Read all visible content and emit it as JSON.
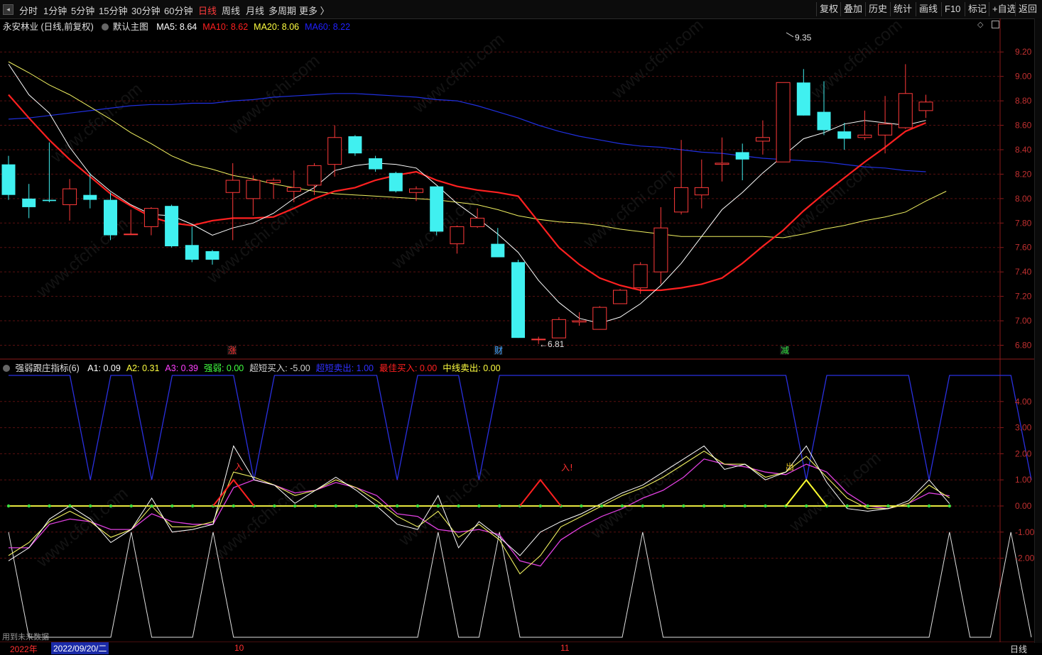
{
  "toolbar": {
    "periods": [
      "分时",
      "1分钟",
      "5分钟",
      "15分钟",
      "30分钟",
      "60分钟",
      "日线",
      "周线",
      "月线",
      "多周期",
      "更多 〉"
    ],
    "active_period": "日线",
    "right_buttons": [
      "复权",
      "叠加",
      "历史",
      "统计",
      "画线",
      "F10",
      "标记",
      "+自选",
      "返回"
    ]
  },
  "main_chart": {
    "stock_title": "永安林业 (日线,前复权)",
    "template": "默认主图",
    "ma": [
      {
        "label": "MA5: 8.64",
        "color": "#ffffff"
      },
      {
        "label": "MA10: 8.62",
        "color": "#ff2020"
      },
      {
        "label": "MA20: 8.06",
        "color": "#ffff40"
      },
      {
        "label": "MA60: 8.22",
        "color": "#2020ff"
      }
    ],
    "y_ticks": [
      "9.20",
      "9.00",
      "8.80",
      "8.60",
      "8.40",
      "8.20",
      "8.00",
      "7.80",
      "7.60",
      "7.40",
      "7.20",
      "7.00",
      "6.80"
    ],
    "high_label": "9.35",
    "low_label": "←6.81",
    "event_marks": [
      {
        "text": "涨",
        "color": "#ff3030"
      },
      {
        "text": "财",
        "color": "#40a0ff"
      },
      {
        "text": "减",
        "color": "#30e040"
      }
    ]
  },
  "indicator": {
    "name": "强弱跟庄指标(6)",
    "values": [
      {
        "label": "A1: 0.09",
        "color": "#ffffff"
      },
      {
        "label": "A2: 0.31",
        "color": "#ffff40"
      },
      {
        "label": "A3: 0.39",
        "color": "#ff40ff"
      },
      {
        "label": "强弱: 0.00",
        "color": "#40ff40"
      },
      {
        "label": "超短买入: -5.00",
        "color": "#d0d0d0"
      },
      {
        "label": "超短卖出: 1.00",
        "color": "#3030ff"
      },
      {
        "label": "最佳买入: 0.00",
        "color": "#ff2020"
      },
      {
        "label": "中线卖出: 0.00",
        "color": "#ffff40"
      }
    ],
    "y_ticks": [
      "4.00",
      "3.00",
      "2.00",
      "1.00",
      "0.00",
      "-1.00",
      "-2.00"
    ],
    "signals": [
      "入",
      "入!",
      "出"
    ],
    "footnote": "用到未来数据"
  },
  "bottom": {
    "year_label": "2022年",
    "cursor_date": "2022/09/20/二",
    "month_labels": [
      "10",
      "11"
    ],
    "period_label": "日线"
  },
  "watermark": "www.cfchi.com",
  "colors": {
    "up": "#ff3a3a",
    "down": "#40f0f0",
    "ma5": "#ffffff",
    "ma10": "#ff2020",
    "ma20": "#f0f060",
    "ma60": "#2030e0",
    "grid": "#5a1010",
    "axis": "#8b1a1a"
  },
  "candles": [
    {
      "o": 8.28,
      "h": 8.35,
      "l": 7.99,
      "c": 8.03
    },
    {
      "o": 8.0,
      "h": 8.12,
      "l": 7.84,
      "c": 7.93
    },
    {
      "o": 7.99,
      "h": 8.46,
      "l": 7.97,
      "c": 7.98
    },
    {
      "o": 7.95,
      "h": 8.16,
      "l": 7.82,
      "c": 8.08
    },
    {
      "o": 8.03,
      "h": 8.21,
      "l": 7.92,
      "c": 7.99
    },
    {
      "o": 7.99,
      "h": 8.05,
      "l": 7.66,
      "c": 7.7
    },
    {
      "o": 7.71,
      "h": 7.91,
      "l": 7.71,
      "c": 7.71
    },
    {
      "o": 7.77,
      "h": 7.93,
      "l": 7.7,
      "c": 7.92
    },
    {
      "o": 7.94,
      "h": 7.95,
      "l": 7.6,
      "c": 7.61
    },
    {
      "o": 7.62,
      "h": 7.77,
      "l": 7.48,
      "c": 7.5
    },
    {
      "o": 7.57,
      "h": 7.58,
      "l": 7.46,
      "c": 7.5
    },
    {
      "o": 8.05,
      "h": 8.29,
      "l": 7.66,
      "c": 8.15
    },
    {
      "o": 8.0,
      "h": 8.19,
      "l": 7.86,
      "c": 8.15
    },
    {
      "o": 8.13,
      "h": 8.17,
      "l": 8.0,
      "c": 8.15
    },
    {
      "o": 8.06,
      "h": 8.23,
      "l": 7.97,
      "c": 8.09
    },
    {
      "o": 8.11,
      "h": 8.29,
      "l": 8.03,
      "c": 8.27
    },
    {
      "o": 8.28,
      "h": 8.6,
      "l": 8.18,
      "c": 8.5
    },
    {
      "o": 8.51,
      "h": 8.52,
      "l": 8.35,
      "c": 8.37
    },
    {
      "o": 8.33,
      "h": 8.35,
      "l": 8.22,
      "c": 8.24
    },
    {
      "o": 8.21,
      "h": 8.22,
      "l": 8.05,
      "c": 8.06
    },
    {
      "o": 8.05,
      "h": 8.1,
      "l": 7.98,
      "c": 8.08
    },
    {
      "o": 8.1,
      "h": 8.1,
      "l": 7.7,
      "c": 7.73
    },
    {
      "o": 7.63,
      "h": 7.78,
      "l": 7.55,
      "c": 7.77
    },
    {
      "o": 7.77,
      "h": 7.92,
      "l": 7.76,
      "c": 7.84
    },
    {
      "o": 7.63,
      "h": 7.76,
      "l": 7.52,
      "c": 7.52
    },
    {
      "o": 7.48,
      "h": 7.5,
      "l": 6.86,
      "c": 6.86
    },
    {
      "o": 6.85,
      "h": 6.87,
      "l": 6.81,
      "c": 6.85
    },
    {
      "o": 6.86,
      "h": 7.03,
      "l": 6.86,
      "c": 7.01
    },
    {
      "o": 6.99,
      "h": 7.07,
      "l": 6.96,
      "c": 7.0
    },
    {
      "o": 6.93,
      "h": 7.12,
      "l": 6.93,
      "c": 7.11
    },
    {
      "o": 7.14,
      "h": 7.26,
      "l": 7.14,
      "c": 7.25
    },
    {
      "o": 7.27,
      "h": 7.48,
      "l": 7.22,
      "c": 7.46
    },
    {
      "o": 7.4,
      "h": 7.93,
      "l": 7.3,
      "c": 7.76
    },
    {
      "o": 7.89,
      "h": 8.48,
      "l": 7.87,
      "c": 8.09
    },
    {
      "o": 8.03,
      "h": 8.32,
      "l": 7.92,
      "c": 8.09
    },
    {
      "o": 8.28,
      "h": 8.5,
      "l": 8.14,
      "c": 8.29
    },
    {
      "o": 8.38,
      "h": 8.45,
      "l": 8.15,
      "c": 8.32
    },
    {
      "o": 8.47,
      "h": 8.64,
      "l": 8.36,
      "c": 8.5
    },
    {
      "o": 8.3,
      "h": 8.73,
      "l": 8.3,
      "c": 8.95
    },
    {
      "o": 8.95,
      "h": 9.06,
      "l": 8.68,
      "c": 8.68
    },
    {
      "o": 8.71,
      "h": 8.96,
      "l": 8.52,
      "c": 8.56
    },
    {
      "o": 8.55,
      "h": 8.62,
      "l": 8.4,
      "c": 8.49
    },
    {
      "o": 8.5,
      "h": 8.72,
      "l": 8.48,
      "c": 8.52
    },
    {
      "o": 8.52,
      "h": 8.84,
      "l": 8.37,
      "c": 8.61
    },
    {
      "o": 8.58,
      "h": 9.1,
      "l": 8.57,
      "c": 8.86
    },
    {
      "o": 8.72,
      "h": 8.85,
      "l": 8.66,
      "c": 8.79
    }
  ],
  "ma_series": {
    "ma5": [
      9.1,
      8.85,
      8.7,
      8.42,
      8.2,
      8.06,
      7.95,
      7.87,
      7.86,
      7.79,
      7.7,
      7.76,
      7.8,
      7.88,
      8.0,
      8.09,
      8.23,
      8.27,
      8.29,
      8.28,
      8.25,
      8.11,
      7.96,
      7.84,
      7.71,
      7.56,
      7.33,
      7.15,
      7.02,
      6.98,
      7.03,
      7.14,
      7.29,
      7.47,
      7.69,
      7.91,
      8.05,
      8.21,
      8.35,
      8.49,
      8.54,
      8.61,
      8.64,
      8.62,
      8.6,
      8.64
    ],
    "ma10": [
      8.85,
      8.66,
      8.48,
      8.32,
      8.18,
      8.04,
      7.94,
      7.85,
      7.8,
      7.78,
      7.82,
      7.84,
      7.84,
      7.85,
      7.92,
      8.0,
      8.06,
      8.09,
      8.15,
      8.19,
      8.22,
      8.15,
      8.1,
      8.07,
      8.05,
      8.02,
      7.81,
      7.6,
      7.46,
      7.35,
      7.29,
      7.25,
      7.25,
      7.27,
      7.3,
      7.35,
      7.47,
      7.61,
      7.74,
      7.9,
      8.04,
      8.17,
      8.3,
      8.42,
      8.55,
      8.62
    ],
    "ma20": [
      9.12,
      9.03,
      8.93,
      8.85,
      8.75,
      8.65,
      8.54,
      8.45,
      8.35,
      8.28,
      8.24,
      8.19,
      8.16,
      8.12,
      8.09,
      8.06,
      8.04,
      8.03,
      8.02,
      8.01,
      8.0,
      7.99,
      7.97,
      7.95,
      7.91,
      7.86,
      7.83,
      7.81,
      7.8,
      7.78,
      7.75,
      7.73,
      7.71,
      7.69,
      7.69,
      7.69,
      7.69,
      7.69,
      7.68,
      7.71,
      7.75,
      7.78,
      7.82,
      7.85,
      7.89,
      7.98,
      8.06
    ],
    "ma60": [
      8.65,
      8.66,
      8.68,
      8.7,
      8.72,
      8.74,
      8.76,
      8.77,
      8.77,
      8.78,
      8.78,
      8.8,
      8.81,
      8.83,
      8.84,
      8.85,
      8.86,
      8.86,
      8.85,
      8.84,
      8.83,
      8.81,
      8.8,
      8.76,
      8.71,
      8.66,
      8.6,
      8.55,
      8.51,
      8.48,
      8.45,
      8.43,
      8.42,
      8.4,
      8.38,
      8.37,
      8.35,
      8.33,
      8.32,
      8.31,
      8.3,
      8.28,
      8.26,
      8.25,
      8.23,
      8.22
    ]
  },
  "indicator_series": {
    "sell_blue": [
      5,
      5,
      5,
      5,
      1,
      5,
      5,
      1,
      5,
      5,
      5,
      5,
      1,
      5,
      5,
      5,
      5,
      5,
      5,
      1,
      5,
      5,
      5,
      1,
      5,
      5,
      5,
      5,
      5,
      5,
      5,
      5,
      5,
      5,
      5,
      5,
      5,
      5,
      5,
      1,
      5,
      5,
      5,
      5,
      5,
      1,
      5,
      5,
      5,
      5,
      1
    ],
    "buy_white": [
      -1,
      -5,
      -5,
      -5,
      -5,
      -5,
      -1,
      -5,
      -5,
      -5,
      -1,
      -5,
      -5,
      -5,
      -5,
      -5,
      -5,
      -5,
      -5,
      -5,
      -5,
      -1,
      -5,
      -5,
      -1,
      -5,
      -5,
      -5,
      -5,
      -5,
      -5,
      -1,
      -5,
      -5,
      -5,
      -5,
      -5,
      -5,
      -5,
      -5,
      -5,
      -5,
      -5,
      -5,
      -5,
      -5,
      -1,
      -5,
      -5,
      -1,
      -5
    ],
    "a1": [
      -2.1,
      -1.6,
      -0.5,
      0.0,
      -0.5,
      -1.4,
      -0.9,
      0.3,
      -1.0,
      -0.9,
      -0.7,
      2.3,
      1.0,
      0.8,
      0.1,
      0.6,
      1.1,
      0.6,
      0.0,
      -0.7,
      -0.9,
      0.4,
      -1.6,
      -0.6,
      -1.2,
      -1.9,
      -1.0,
      -0.6,
      -0.3,
      0.1,
      0.5,
      0.8,
      1.3,
      1.8,
      2.3,
      1.4,
      1.6,
      1.0,
      1.3,
      2.3,
      0.9,
      -0.1,
      -0.2,
      -0.1,
      0.2,
      1.0,
      0.09
    ],
    "a2": [
      -1.9,
      -1.4,
      -0.6,
      -0.2,
      -0.6,
      -1.2,
      -0.9,
      0.0,
      -0.8,
      -0.8,
      -0.6,
      1.3,
      1.1,
      0.8,
      0.4,
      0.6,
      1.0,
      0.7,
      0.2,
      -0.4,
      -0.8,
      -0.2,
      -1.2,
      -0.7,
      -1.3,
      -2.6,
      -1.9,
      -0.8,
      -0.4,
      0.0,
      0.4,
      0.7,
      1.1,
      1.6,
      2.1,
      1.6,
      1.6,
      1.1,
      1.3,
      1.9,
      1.1,
      0.3,
      -0.1,
      -0.1,
      0.1,
      0.8,
      0.31
    ],
    "a3": [
      -1.6,
      -1.6,
      -0.7,
      -0.5,
      -0.6,
      -0.9,
      -0.9,
      -0.3,
      -0.6,
      -0.7,
      -0.7,
      0.7,
      1.0,
      0.8,
      0.5,
      0.6,
      0.9,
      0.7,
      0.4,
      -0.3,
      -0.4,
      -0.9,
      -1.0,
      -0.9,
      -1.1,
      -2.1,
      -2.3,
      -1.3,
      -0.8,
      -0.4,
      -0.1,
      0.3,
      0.6,
      1.1,
      1.8,
      1.6,
      1.5,
      1.3,
      1.2,
      1.6,
      1.3,
      0.5,
      0.0,
      -0.1,
      0.1,
      0.5,
      0.39
    ],
    "best_buy": [
      0,
      0,
      0,
      0,
      0,
      0,
      0,
      0,
      0,
      0,
      0,
      1,
      0,
      0,
      0,
      0,
      0,
      0,
      0,
      0,
      0,
      0,
      0,
      0,
      0,
      0,
      1,
      0,
      0,
      0,
      0,
      0,
      0,
      0,
      0,
      0,
      0,
      0,
      0,
      0,
      0,
      0,
      0,
      0,
      0,
      0,
      0
    ],
    "mid_sell": [
      0,
      0,
      0,
      0,
      0,
      0,
      0,
      0,
      0,
      0,
      0,
      0,
      0,
      0,
      0,
      0,
      0,
      0,
      0,
      0,
      0,
      0,
      0,
      0,
      0,
      0,
      0,
      0,
      0,
      0,
      0,
      0,
      0,
      0,
      0,
      0,
      0,
      0,
      0,
      1,
      0,
      0,
      0,
      0,
      0,
      0,
      0
    ]
  }
}
